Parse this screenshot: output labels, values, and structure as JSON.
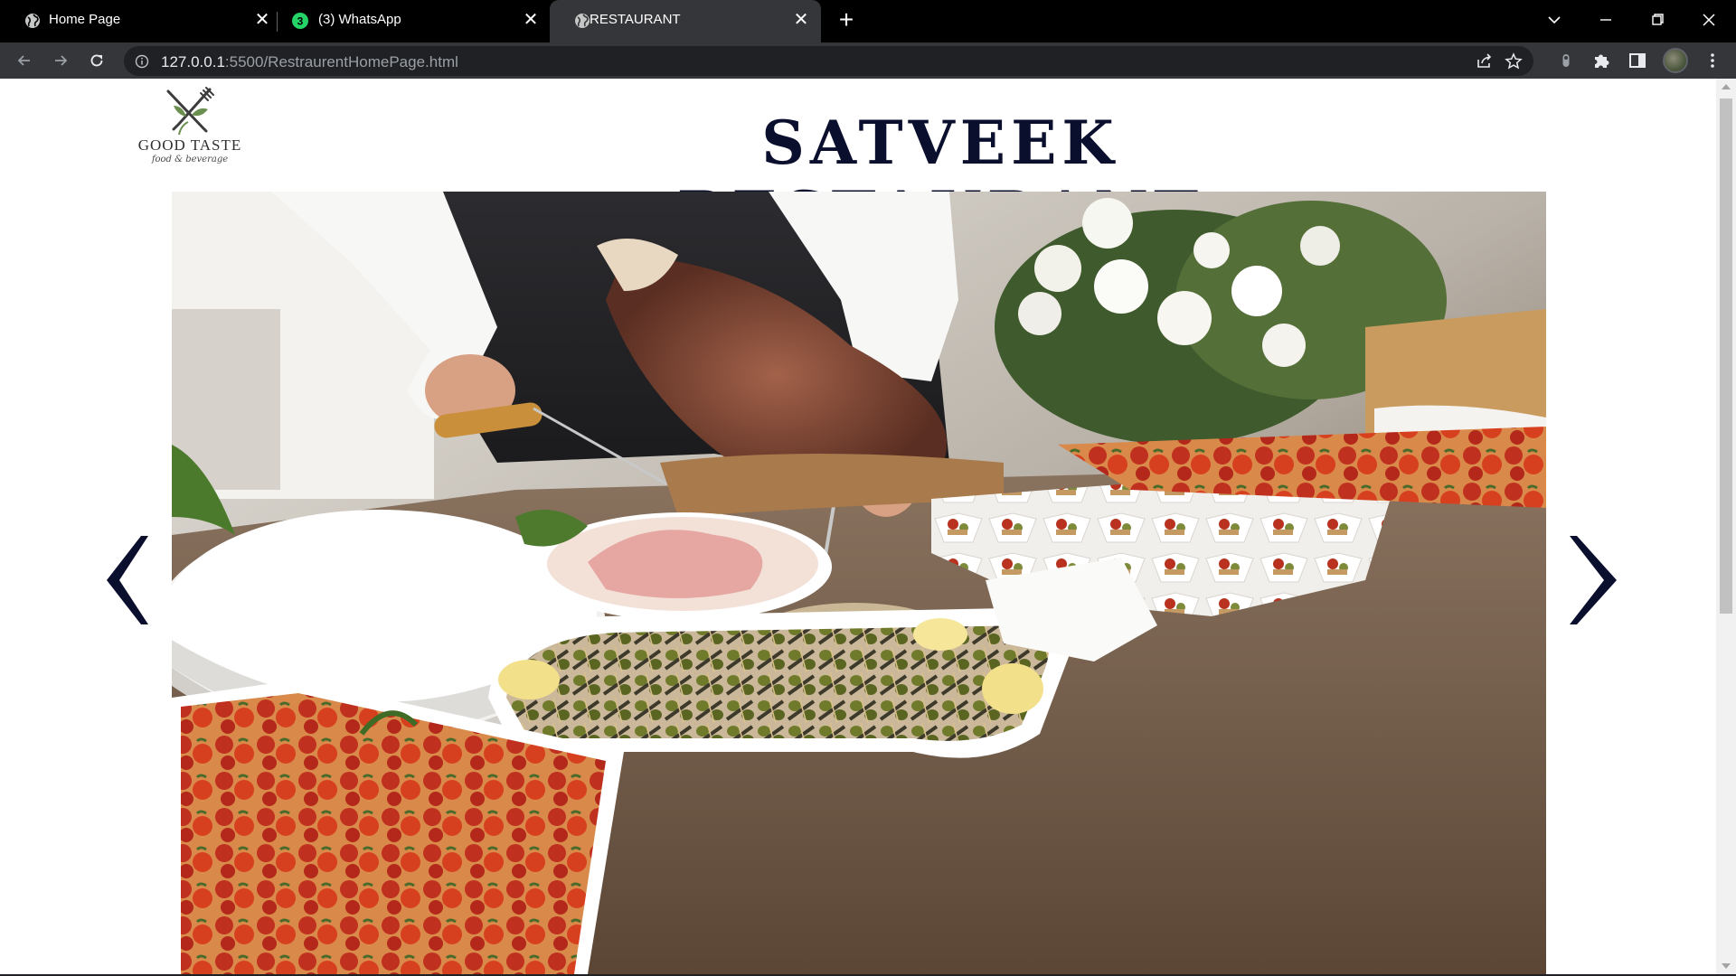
{
  "browser": {
    "tabs": [
      {
        "title": "Home Page",
        "active": false,
        "icon": "globe-icon"
      },
      {
        "title": "(3) WhatsApp",
        "active": false,
        "icon": "whatsapp-icon",
        "badge": "3"
      },
      {
        "title": "RESTAURANT",
        "active": true,
        "icon": "globe-icon"
      }
    ],
    "address": {
      "host": "127.0.0.1",
      "rest": ":5500/RestraurentHomePage.html"
    }
  },
  "page": {
    "logo": {
      "title": "GOOD TASTE",
      "subtitle": "food & beverage"
    },
    "title": "SATVEEK RESTAURANT",
    "carousel": {
      "prev_icon": "chevron-left-icon",
      "next_icon": "chevron-right-icon"
    }
  },
  "colors": {
    "title": "#0b0f2e",
    "arrows": "#0b0f2e",
    "tabstrip": "#000000",
    "toolbar": "#35363a"
  }
}
